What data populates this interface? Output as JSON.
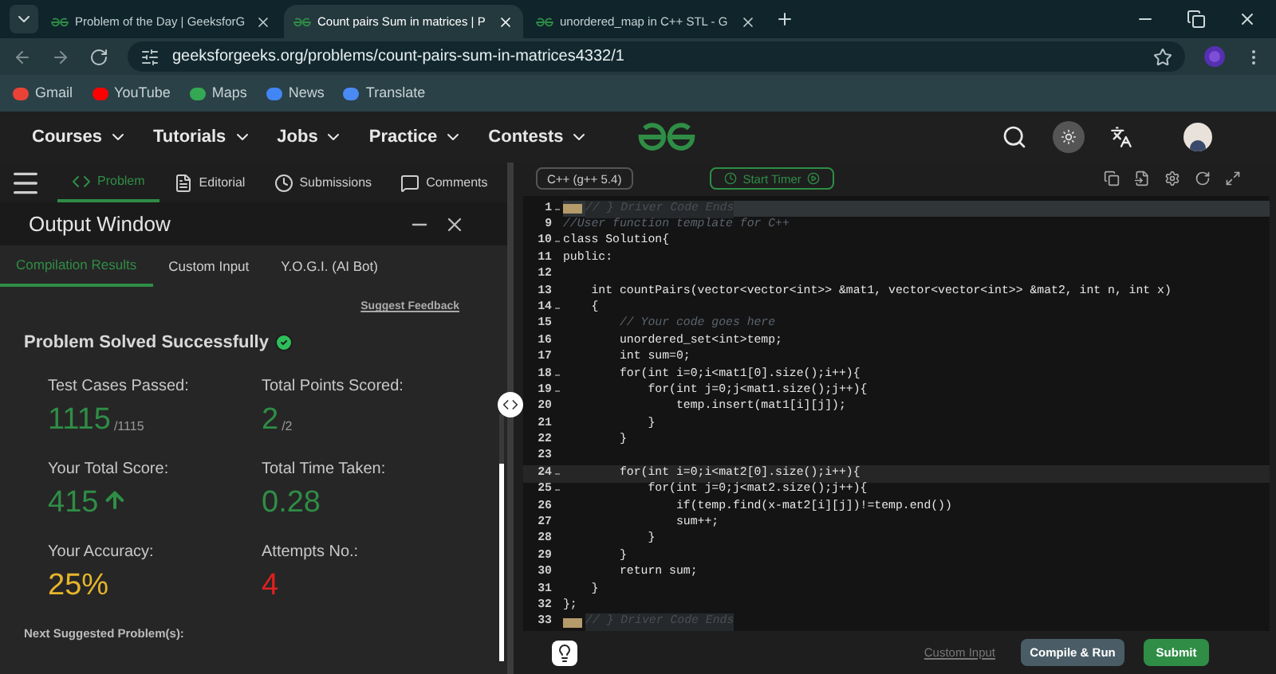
{
  "browser": {
    "tabs": [
      {
        "title": "Problem of the Day | GeeksforG",
        "selected": false
      },
      {
        "title": "Count pairs Sum in matrices | P",
        "selected": true
      },
      {
        "title": "unordered_map in C++ STL - G",
        "selected": false
      }
    ],
    "url": "geeksforgeeks.org/problems/count-pairs-sum-in-matrices4332/1",
    "bookmarks": [
      {
        "label": "Gmail",
        "color": "#ea4335"
      },
      {
        "label": "YouTube",
        "color": "#ff0000"
      },
      {
        "label": "Maps",
        "color": "#34a853"
      },
      {
        "label": "News",
        "color": "#4285f4"
      },
      {
        "label": "Translate",
        "color": "#4a8af4"
      }
    ]
  },
  "site_nav": {
    "menus": [
      "Courses",
      "Tutorials",
      "Jobs",
      "Practice",
      "Contests"
    ]
  },
  "problem_tabs": [
    {
      "label": "Problem",
      "selected": true,
      "kind": "code"
    },
    {
      "label": "Editorial",
      "selected": false,
      "kind": "doc"
    },
    {
      "label": "Submissions",
      "selected": false,
      "kind": "clock"
    },
    {
      "label": "Comments",
      "selected": false,
      "kind": "chat"
    }
  ],
  "output_window": {
    "title": "Output Window",
    "tabs": [
      {
        "label": "Compilation Results",
        "selected": true
      },
      {
        "label": "Custom Input",
        "selected": false
      },
      {
        "label": "Y.O.G.I. (AI Bot)",
        "selected": false
      }
    ],
    "feedback_link": "Suggest Feedback",
    "status": "Problem Solved Successfully",
    "stats": [
      {
        "label": "Test Cases Passed:",
        "value": "1115",
        "suffix": "/1115",
        "color": "#2f8d46"
      },
      {
        "label": "Total Points Scored:",
        "value": "2",
        "suffix": "/2",
        "color": "#2f8d46"
      },
      {
        "label": "Your Total Score:",
        "value": "415",
        "color": "#2f8d46",
        "rising": true
      },
      {
        "label": "Total Time Taken:",
        "value": "0.28",
        "color": "#2f8d46"
      },
      {
        "label": "Your Accuracy:",
        "value": "25%",
        "color": "#e7b52c"
      },
      {
        "label": "Attempts No.:",
        "value": "4",
        "color": "#e02020"
      }
    ],
    "next_label": "Next Suggested Problem(s):"
  },
  "editor": {
    "language": "C++ (g++ 5.4)",
    "timer_button": "Start Timer",
    "lines": [
      {
        "number": "1",
        "text": "// } Driver Code Ends",
        "kind": "fold",
        "foldable": true,
        "active": false
      },
      {
        "number": "9",
        "text": "//User function template for C++",
        "kind": "comment",
        "foldable": false,
        "active": false
      },
      {
        "number": "10",
        "text": "class Solution{",
        "kind": "code",
        "foldable": true,
        "active": false
      },
      {
        "number": "11",
        "text": "public:",
        "kind": "code",
        "foldable": false,
        "active": false
      },
      {
        "number": "12",
        "kind": "code",
        "foldable": false,
        "active": false
      },
      {
        "number": "13",
        "text": "    int countPairs(vector<vector<int>> &mat1, vector<vector<int>> &mat2, int n, int x)",
        "kind": "code",
        "foldable": false,
        "active": false
      },
      {
        "number": "14",
        "text": "    {",
        "kind": "code",
        "foldable": true,
        "active": false
      },
      {
        "number": "15",
        "text": "        // Your code goes here",
        "kind": "comment",
        "foldable": false,
        "active": false
      },
      {
        "number": "16",
        "text": "        unordered_set<int>temp;",
        "kind": "code",
        "foldable": false,
        "active": false
      },
      {
        "number": "17",
        "text": "        int sum=0;",
        "kind": "code",
        "foldable": false,
        "active": false
      },
      {
        "number": "18",
        "text": "        for(int i=0;i<mat1[0].size();i++){",
        "kind": "code",
        "foldable": true,
        "active": false
      },
      {
        "number": "19",
        "text": "            for(int j=0;j<mat1.size();j++){",
        "kind": "code",
        "foldable": true,
        "active": false
      },
      {
        "number": "20",
        "text": "                temp.insert(mat1[i][j]);",
        "kind": "code",
        "foldable": false,
        "active": false
      },
      {
        "number": "21",
        "text": "            }",
        "kind": "code",
        "foldable": false,
        "active": false
      },
      {
        "number": "22",
        "text": "        }",
        "kind": "code",
        "foldable": false,
        "active": false
      },
      {
        "number": "23",
        "kind": "code",
        "foldable": false,
        "active": false
      },
      {
        "number": "24",
        "text": "        for(int i=0;i<mat2[0].size();i++){",
        "kind": "code",
        "foldable": true,
        "active": true
      },
      {
        "number": "25",
        "text": "            for(int j=0;j<mat2.size();j++){",
        "kind": "code",
        "foldable": true,
        "active": false
      },
      {
        "number": "26",
        "text": "                if(temp.find(x-mat2[i][j])!=temp.end())",
        "kind": "code",
        "foldable": false,
        "active": false
      },
      {
        "number": "27",
        "text": "                sum++;",
        "kind": "code",
        "foldable": false,
        "active": false
      },
      {
        "number": "28",
        "text": "            }",
        "kind": "code",
        "foldable": false,
        "active": false
      },
      {
        "number": "29",
        "text": "        }",
        "kind": "code",
        "foldable": false,
        "active": false
      },
      {
        "number": "30",
        "text": "        return sum;",
        "kind": "code",
        "foldable": false,
        "active": false
      },
      {
        "number": "31",
        "text": "    }",
        "kind": "code",
        "foldable": false,
        "active": false
      },
      {
        "number": "32",
        "text": "};",
        "kind": "code",
        "foldable": false,
        "active": false
      },
      {
        "number": "33",
        "text": "// } Driver Code Ends",
        "kind": "fold",
        "foldable": false,
        "active": false
      }
    ],
    "custom_input_link": "Custom Input",
    "compile_button": "Compile & Run",
    "submit_button": "Submit"
  }
}
